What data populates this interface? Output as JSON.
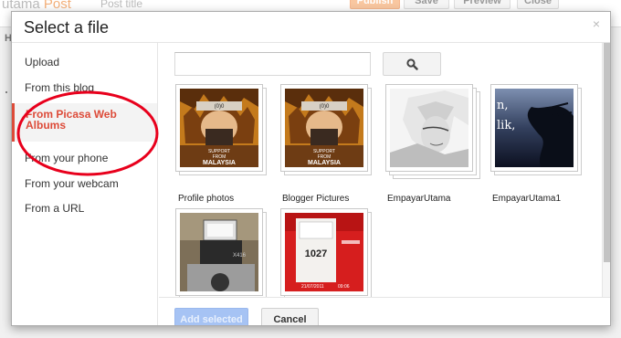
{
  "background": {
    "brand_faded": "utama",
    "brand_post": "Post",
    "title_placeholder": "Post title",
    "buttons": {
      "publish": "Publish",
      "save": "Save",
      "preview": "Preview",
      "close": "Close"
    },
    "heading_letter": "H"
  },
  "dialog": {
    "title": "Select a file",
    "close_glyph": "×"
  },
  "sidebar": {
    "items": [
      {
        "label": "Upload"
      },
      {
        "label": "From this blog"
      },
      {
        "label": "From Picasa Web Albums"
      },
      {
        "label": "From your phone"
      },
      {
        "label": "From your webcam"
      },
      {
        "label": "From a URL"
      }
    ],
    "active_index": 2
  },
  "search": {
    "value": "",
    "placeholder": ""
  },
  "albums": [
    {
      "label": "Profile photos"
    },
    {
      "label": "Blogger Pictures"
    },
    {
      "label": "EmpayarUtama"
    },
    {
      "label": "EmpayarUtama1"
    },
    {
      "label": ""
    },
    {
      "label": ""
    }
  ],
  "thumb_text": {
    "brand_top": "SUPPORT",
    "brand_mid": "FROM",
    "brand_country": "MALAYSIA",
    "headband": "(0)0",
    "photo4_lines": [
      "n,",
      "lik,"
    ],
    "camera_model": "X416",
    "ticket_number": "1027",
    "ticket_date": "21/07/2011",
    "ticket_time": "09:06"
  },
  "footer": {
    "add_label": "Add selected",
    "cancel_label": "Cancel"
  },
  "colors": {
    "accent_red": "#dd4b39",
    "button_blue_disabled": "#a6c3f4",
    "highlight_circle": "#e8001c"
  }
}
